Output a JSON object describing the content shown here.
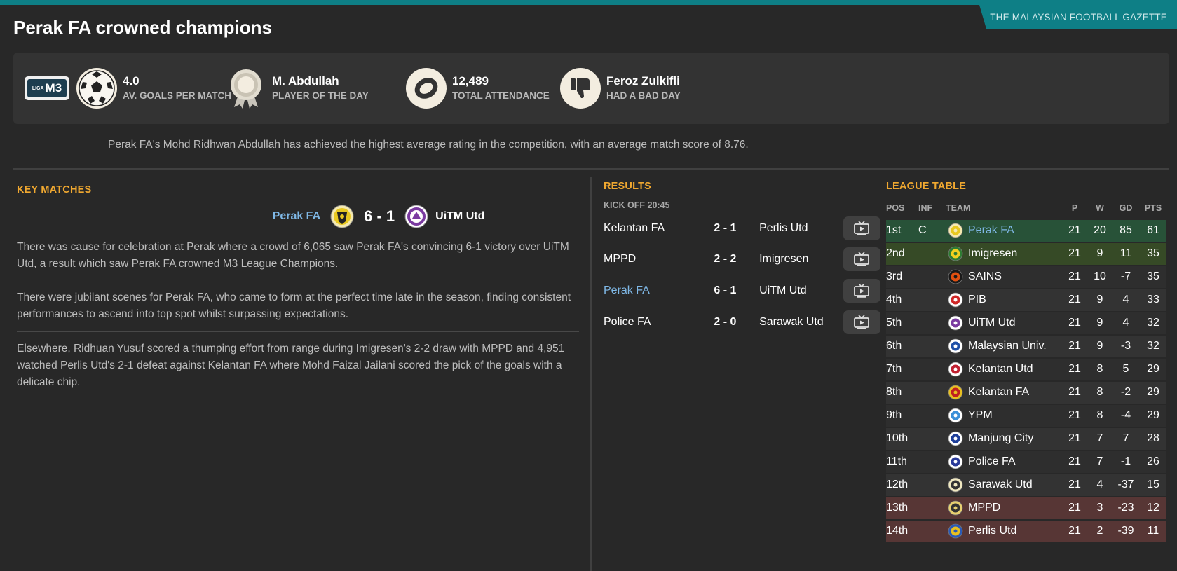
{
  "gazette": "THE MALAYSIAN FOOTBALL GAZETTE",
  "title": "Perak FA crowned champions",
  "stats": {
    "league_logo_small": "LIGA",
    "league_logo_big": "M3",
    "goals_value": "4.0",
    "goals_label": "AV. GOALS PER MATCH",
    "potd_value": "M. Abdullah",
    "potd_label": "PLAYER OF THE DAY",
    "attendance_value": "12,489",
    "attendance_label": "TOTAL ATTENDANCE",
    "bad_value": "Feroz Zulkifli",
    "bad_label": "HAD A BAD DAY"
  },
  "summary": "Perak FA's Mohd Ridhwan Abdullah has achieved the highest average rating in the competition, with an average match score of 8.76.",
  "key_matches": {
    "title": "KEY MATCHES",
    "home": "Perak FA",
    "score": "6 - 1",
    "away": "UiTM Utd",
    "p1": "There was cause for celebration at Perak where a crowd of 6,065 saw Perak FA's convincing 6-1 victory over UiTM Utd, a result which saw Perak FA crowned M3 League Champions.",
    "p2": "There were jubilant scenes for Perak FA, who came to form at the perfect time late in the season, finding consistent performances to ascend into top spot whilst surpassing expectations.",
    "p3": "Elsewhere, Ridhuan Yusuf scored a thumping effort from range during Imigresen's 2-2 draw with MPPD and 4,951 watched Perlis Utd's 2-1 defeat against Kelantan FA where Mohd Faizal Jailani scored the pick of the goals with a delicate chip."
  },
  "results": {
    "title": "RESULTS",
    "kickoff": "KICK OFF 20:45",
    "rows": [
      {
        "home": "Kelantan FA",
        "score": "2 - 1",
        "away": "Perlis Utd"
      },
      {
        "home": "MPPD",
        "score": "2 - 2",
        "away": "Imigresen"
      },
      {
        "home": "Perak FA",
        "score": "6 - 1",
        "away": "UiTM Utd"
      },
      {
        "home": "Police FA",
        "score": "2 - 0",
        "away": "Sarawak Utd"
      }
    ]
  },
  "league_table": {
    "title": "LEAGUE TABLE",
    "headers": {
      "pos": "POS",
      "inf": "INF",
      "team": "TEAM",
      "p": "P",
      "w": "W",
      "gd": "GD",
      "pts": "PTS"
    },
    "rows": [
      {
        "pos": "1st",
        "inf": "C",
        "team": "Perak FA",
        "p": "21",
        "w": "20",
        "gd": "85",
        "pts": "61"
      },
      {
        "pos": "2nd",
        "inf": "",
        "team": "Imigresen",
        "p": "21",
        "w": "9",
        "gd": "11",
        "pts": "35"
      },
      {
        "pos": "3rd",
        "inf": "",
        "team": "SAINS",
        "p": "21",
        "w": "10",
        "gd": "-7",
        "pts": "35"
      },
      {
        "pos": "4th",
        "inf": "",
        "team": "PIB",
        "p": "21",
        "w": "9",
        "gd": "4",
        "pts": "33"
      },
      {
        "pos": "5th",
        "inf": "",
        "team": "UiTM Utd",
        "p": "21",
        "w": "9",
        "gd": "4",
        "pts": "32"
      },
      {
        "pos": "6th",
        "inf": "",
        "team": "Malaysian Univ.",
        "p": "21",
        "w": "9",
        "gd": "-3",
        "pts": "32"
      },
      {
        "pos": "7th",
        "inf": "",
        "team": "Kelantan Utd",
        "p": "21",
        "w": "8",
        "gd": "5",
        "pts": "29"
      },
      {
        "pos": "8th",
        "inf": "",
        "team": "Kelantan FA",
        "p": "21",
        "w": "8",
        "gd": "-2",
        "pts": "29"
      },
      {
        "pos": "9th",
        "inf": "",
        "team": "YPM",
        "p": "21",
        "w": "8",
        "gd": "-4",
        "pts": "29"
      },
      {
        "pos": "10th",
        "inf": "",
        "team": "Manjung City",
        "p": "21",
        "w": "7",
        "gd": "7",
        "pts": "28"
      },
      {
        "pos": "11th",
        "inf": "",
        "team": "Police FA",
        "p": "21",
        "w": "7",
        "gd": "-1",
        "pts": "26"
      },
      {
        "pos": "12th",
        "inf": "",
        "team": "Sarawak Utd",
        "p": "21",
        "w": "4",
        "gd": "-37",
        "pts": "15"
      },
      {
        "pos": "13th",
        "inf": "",
        "team": "MPPD",
        "p": "21",
        "w": "3",
        "gd": "-23",
        "pts": "12"
      },
      {
        "pos": "14th",
        "inf": "",
        "team": "Perlis Utd",
        "p": "21",
        "w": "2",
        "gd": "-39",
        "pts": "11"
      }
    ]
  },
  "colors": {
    "accent_teal": "#0e7f86",
    "section_orange": "#f0a830",
    "link_blue": "#7fb8e6",
    "champion_row": "#285238",
    "promotion_row": "#364a26",
    "relegation_row": "#573635"
  }
}
